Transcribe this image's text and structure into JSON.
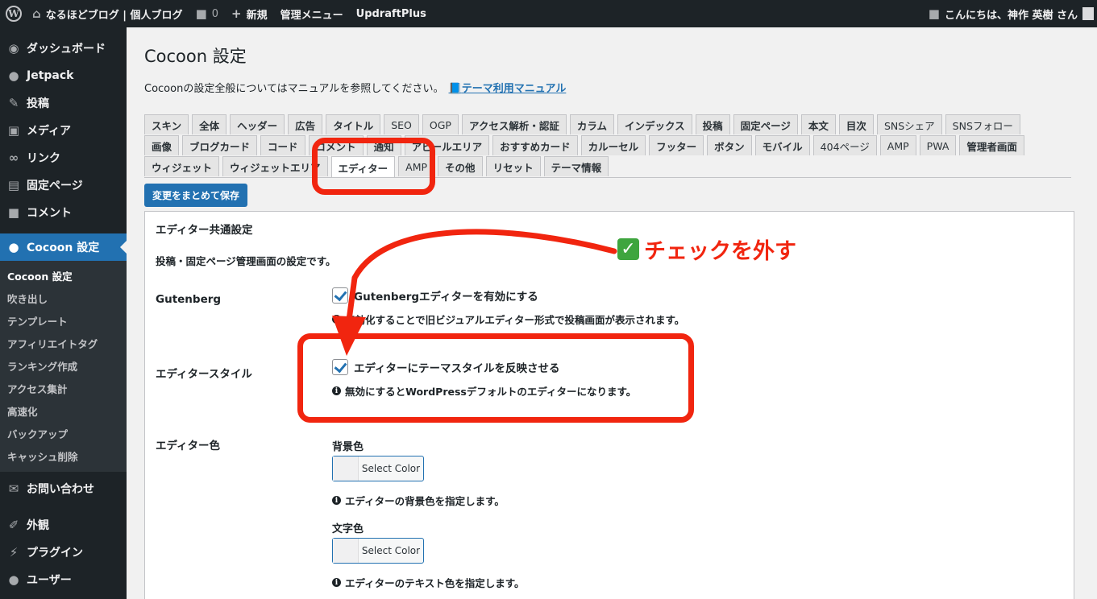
{
  "adminbar": {
    "site_name": "なるほどブログ | 個人ブログ",
    "comments_count": "0",
    "new_label": "新規",
    "admin_menu_label": "管理メニュー",
    "updraft_label": "UpdraftPlus",
    "greeting": "こんにちは、神作 英樹 さん"
  },
  "sidebar": {
    "items_top": [
      {
        "label": "ダッシュボード",
        "icon": "dashboard-icon"
      },
      {
        "label": "Jetpack",
        "icon": "jetpack-icon"
      },
      {
        "label": "投稿",
        "icon": "pin-icon"
      },
      {
        "label": "メディア",
        "icon": "media-icon"
      },
      {
        "label": "リンク",
        "icon": "link-icon"
      },
      {
        "label": "固定ページ",
        "icon": "page-icon"
      },
      {
        "label": "コメント",
        "icon": "comment-icon"
      }
    ],
    "current": {
      "label": "Cocoon 設定",
      "icon": "cocoon-icon"
    },
    "submenu": [
      "Cocoon 設定",
      "吹き出し",
      "テンプレート",
      "アフィリエイトタグ",
      "ランキング作成",
      "アクセス集計",
      "高速化",
      "バックアップ",
      "キャッシュ削除"
    ],
    "items_bottom": [
      {
        "label": "お問い合わせ",
        "icon": "mail-icon"
      },
      {
        "label": "外観",
        "icon": "appearance-icon"
      },
      {
        "label": "プラグイン",
        "icon": "plugin-icon"
      },
      {
        "label": "ユーザー",
        "icon": "user-icon"
      }
    ]
  },
  "main": {
    "title": "Cocoon 設定",
    "manual_text": "Cocoonの設定全般についてはマニュアルを参照してください。",
    "manual_link": "テーマ利用マニュアル",
    "tabs_row1": [
      "スキン",
      "全体",
      "ヘッダー",
      "広告",
      "タイトル",
      "SEO",
      "OGP",
      "アクセス解析・認証",
      "カラム",
      "インデックス",
      "投稿",
      "固定ページ",
      "本文",
      "目次",
      "SNSシェア",
      "SNSフォロー"
    ],
    "tabs_row2": [
      "画像",
      "ブログカード",
      "コード",
      "コメント",
      "通知",
      "アピールエリア",
      "おすすめカード",
      "カルーセル",
      "フッター",
      "ボタン",
      "モバイル",
      "404ページ",
      "AMP",
      "PWA",
      "管理者画面"
    ],
    "tabs_row3": [
      "ウィジェット",
      "ウィジェットエリア",
      "エディター",
      "AMP",
      "その他",
      "リセット",
      "テーマ情報"
    ],
    "save_button": "変更をまとめて保存",
    "panel": {
      "title": "エディター共通設定",
      "description": "投稿・固定ページ管理画面の設定です。",
      "gutenberg_label": "Gutenberg",
      "gutenberg_checkbox": "Gutenbergエディターを有効にする",
      "gutenberg_checked": true,
      "gutenberg_info": "無効化することで旧ビジュアルエディター形式で投稿画面が表示されます。",
      "style_label": "エディタースタイル",
      "style_checkbox": "エディターにテーマスタイルを反映させる",
      "style_checked": true,
      "style_info": "無効にするとWordPressデフォルトのエディターになります。",
      "color_label": "エディター色",
      "bg_color_label": "背景色",
      "select_color": "Select Color",
      "bg_color_info": "エディターの背景色を指定します。",
      "text_color_label": "文字色",
      "text_color_info": "エディターのテキスト色を指定します。"
    }
  },
  "annotation": {
    "text": "チェックを外す",
    "color": "#f1250f"
  }
}
